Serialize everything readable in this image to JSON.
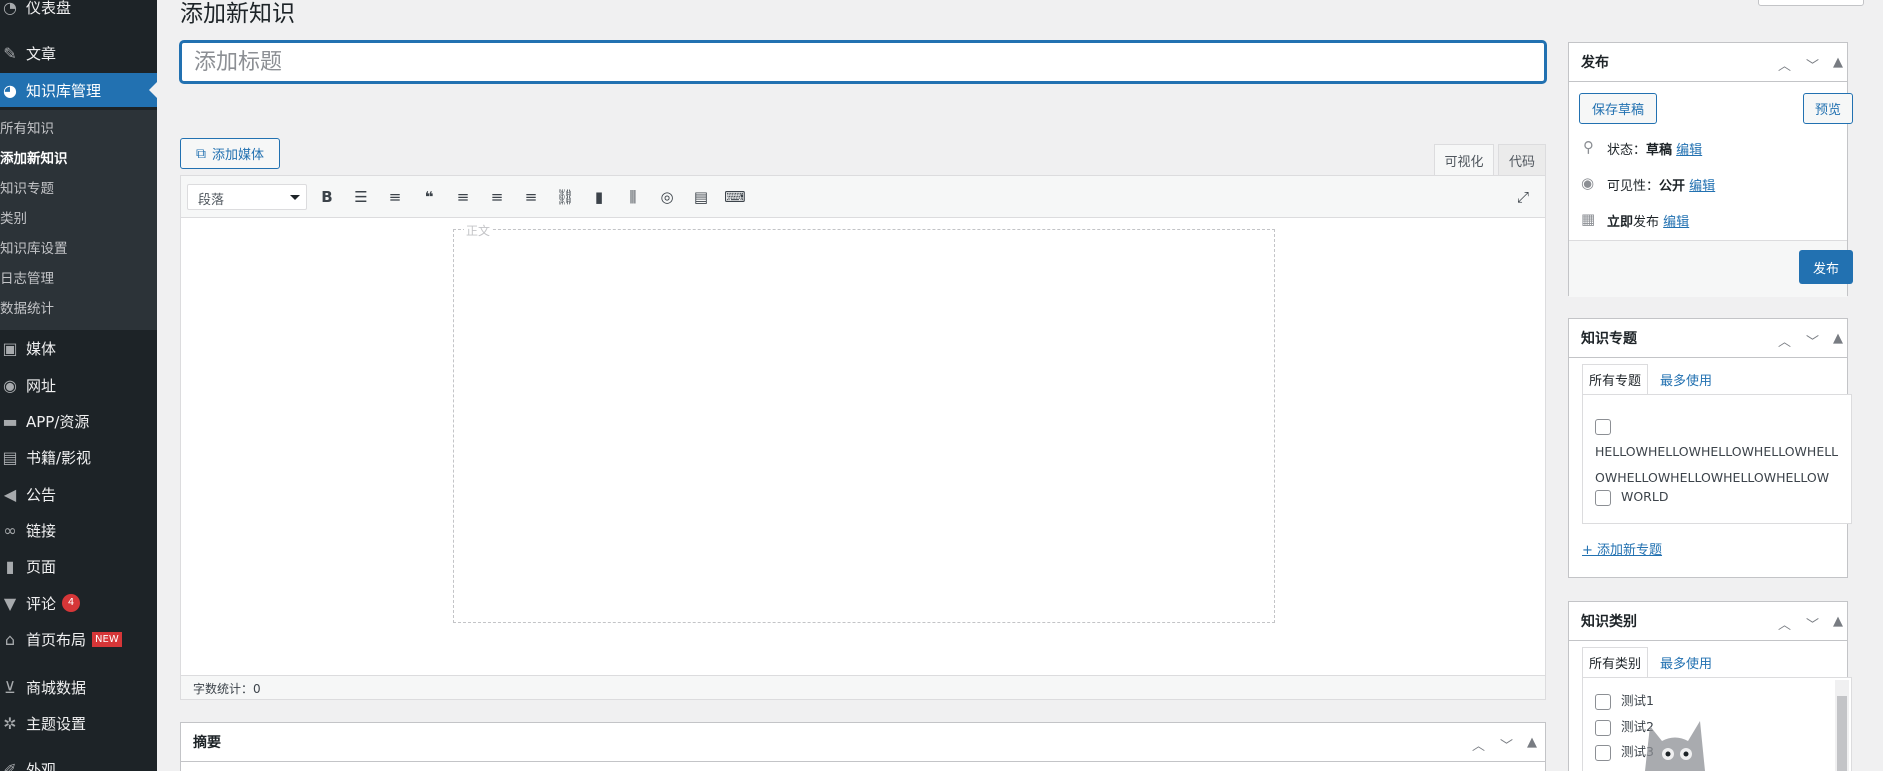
{
  "sidebar": {
    "top_item": "仪表盘",
    "items": [
      {
        "label": "文章",
        "icon": "pin-icon"
      },
      {
        "label": "知识库管理",
        "icon": "palette-icon"
      },
      {
        "label": "媒体",
        "icon": "media-icon"
      },
      {
        "label": "网址",
        "icon": "globe-icon"
      },
      {
        "label": "APP/资源",
        "icon": "app-icon"
      },
      {
        "label": "书籍/影视",
        "icon": "book-icon"
      },
      {
        "label": "公告",
        "icon": "megaphone-icon"
      },
      {
        "label": "链接",
        "icon": "link-icon"
      },
      {
        "label": "页面",
        "icon": "page-icon"
      },
      {
        "label": "评论",
        "icon": "comment-icon",
        "badge": "4"
      },
      {
        "label": "首页布局",
        "icon": "home-icon",
        "tag": "NEW"
      },
      {
        "label": "商城数据",
        "icon": "cart-icon"
      },
      {
        "label": "主题设置",
        "icon": "gear-icon"
      },
      {
        "label": "外观",
        "icon": "brush-icon"
      }
    ],
    "submenu": [
      "所有知识",
      "添加新知识",
      "知识专题",
      "类别",
      "知识库设置",
      "日志管理",
      "数据统计"
    ]
  },
  "page": {
    "title": "添加新知识",
    "title_placeholder": "添加标题",
    "add_media": "添加媒体",
    "tab_visual": "可视化",
    "tab_code": "代码",
    "format_select": "段落",
    "content_placeholder": "正文",
    "word_count": "字数统计：0",
    "excerpt_title": "摘要"
  },
  "publish": {
    "title": "发布",
    "save_draft": "保存草稿",
    "preview": "预览",
    "status_label": "状态：",
    "status_value": "草稿",
    "visibility_label": "可见性：",
    "visibility_value": "公开",
    "schedule_label": "立即",
    "schedule_suffix": "发布",
    "edit": "编辑",
    "publish_button": "发布"
  },
  "topics": {
    "title": "知识专题",
    "tab_all": "所有专题",
    "tab_most": "最多使用",
    "items": [
      "HELLOWHELLOWHELLOWHELLOWHELLOWHELLOWHELLOWHELLOWHELLOW",
      "WORLD"
    ],
    "add_new": "+ 添加新专题"
  },
  "categories": {
    "title": "知识类别",
    "tab_all": "所有类别",
    "tab_most": "最多使用",
    "items": [
      "测试1",
      "测试2",
      "测试3"
    ]
  }
}
